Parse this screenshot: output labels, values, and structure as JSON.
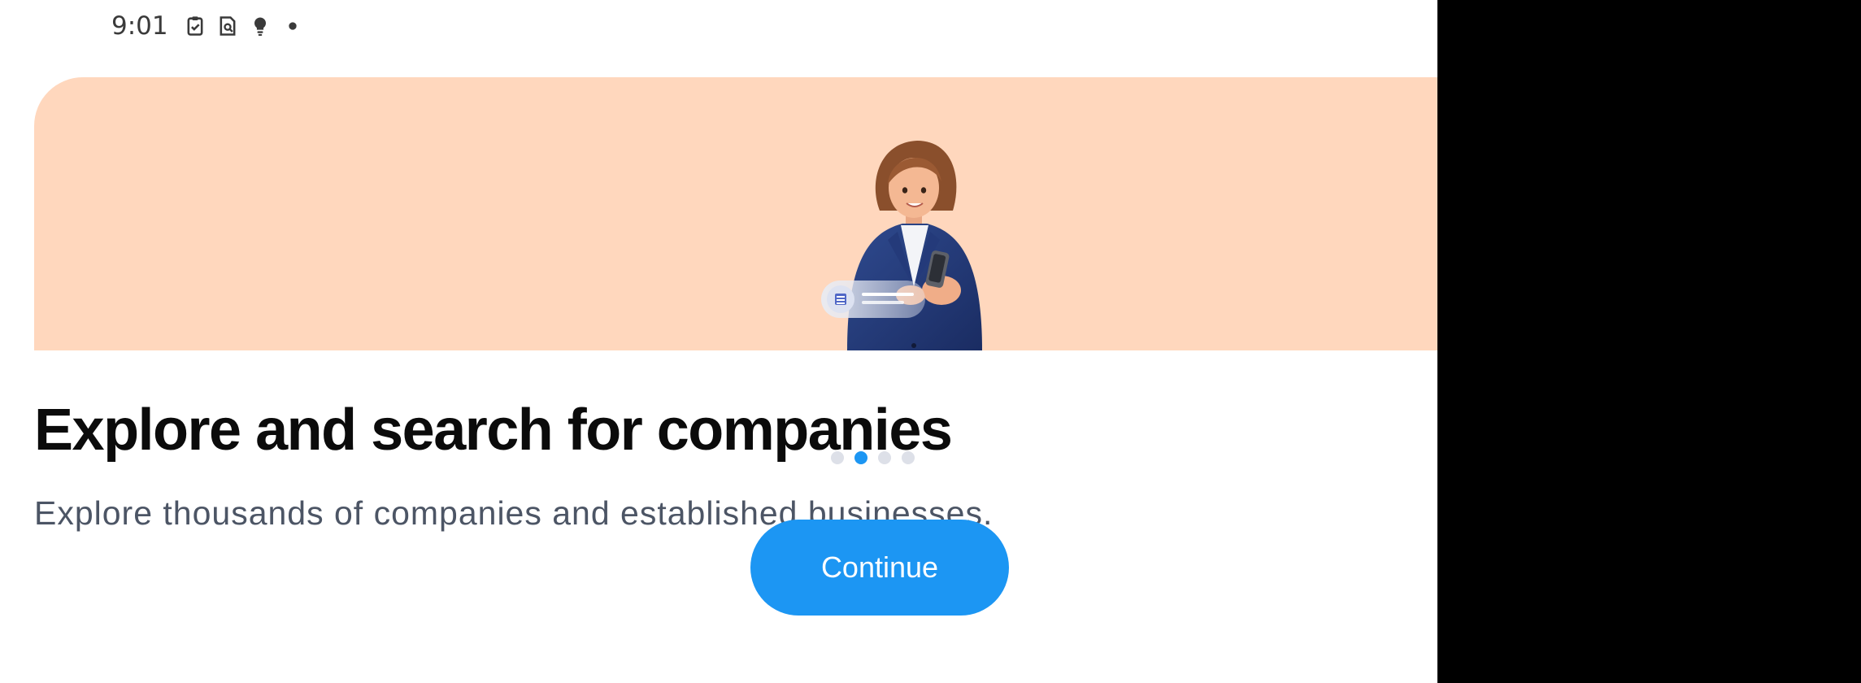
{
  "status_bar": {
    "time": "9:01",
    "icons": [
      "clipboard-check-icon",
      "document-search-icon",
      "lightbulb-icon",
      "dot-icon"
    ]
  },
  "onboarding": {
    "title": "Explore and search for companies",
    "subtitle": "Explore thousands of companies and established businesses.",
    "illustration": "businesswoman-with-phone-illustration",
    "pager": {
      "total": 4,
      "active_index": 2
    },
    "continue_label": "Continue"
  },
  "colors": {
    "hero_background": "#FFD7BD",
    "accent": "#1C96F3",
    "title_text": "#0B0B0B",
    "subtitle_text": "#4C5565",
    "inactive_dot": "#DDE0E8",
    "device_background": "#000000"
  }
}
